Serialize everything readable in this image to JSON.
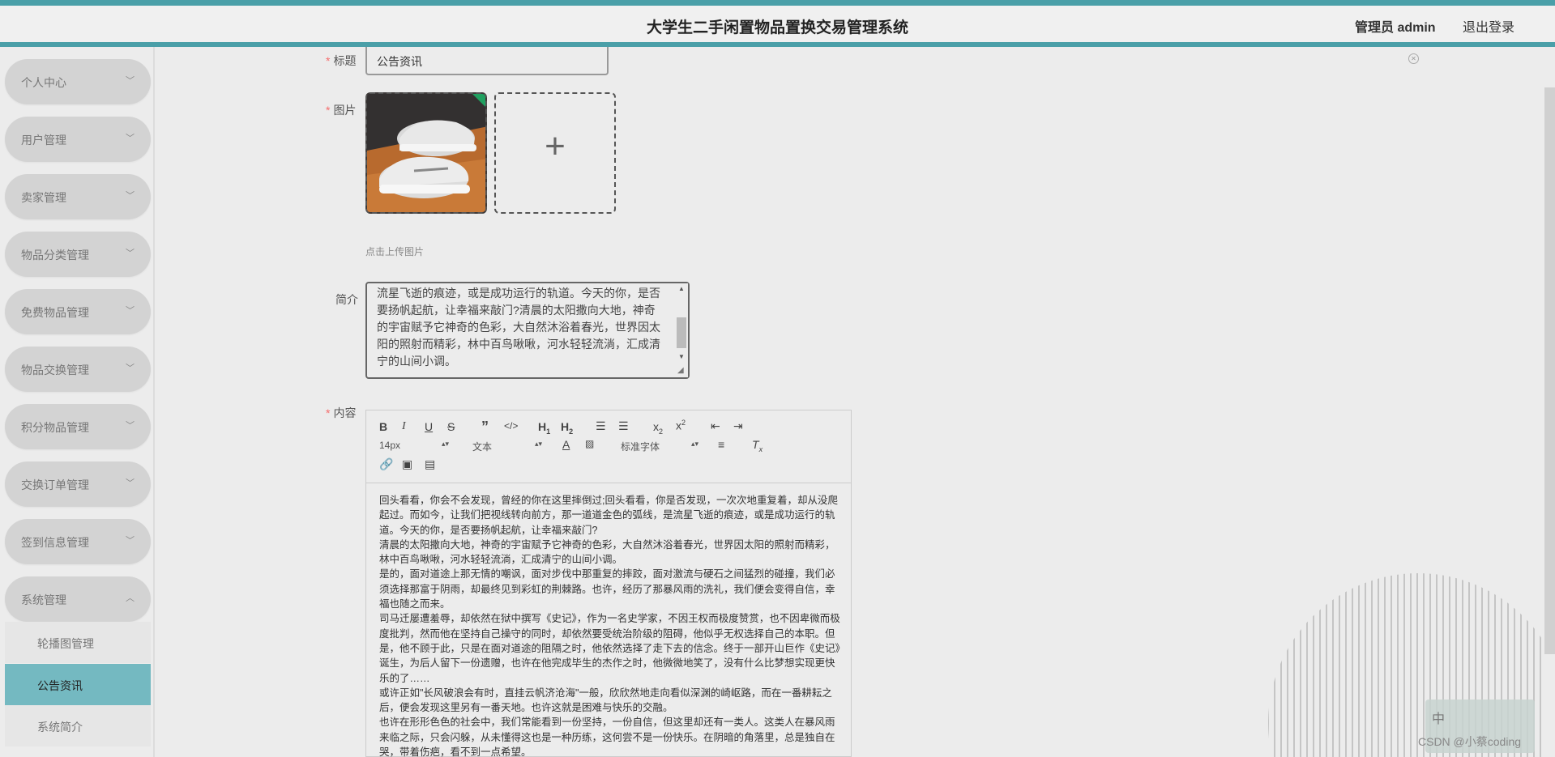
{
  "header": {
    "title": "大学生二手闲置物品置换交易管理系统",
    "user": "管理员 admin",
    "logout": "退出登录"
  },
  "sidebar": {
    "items": [
      {
        "label": "个人中心"
      },
      {
        "label": "用户管理"
      },
      {
        "label": "卖家管理"
      },
      {
        "label": "物品分类管理"
      },
      {
        "label": "免费物品管理"
      },
      {
        "label": "物品交换管理"
      },
      {
        "label": "积分物品管理"
      },
      {
        "label": "交换订单管理"
      },
      {
        "label": "签到信息管理"
      },
      {
        "label": "系统管理"
      }
    ],
    "submenu": [
      {
        "label": "轮播图管理"
      },
      {
        "label": "公告资讯"
      },
      {
        "label": "系统简介"
      }
    ],
    "active_submenu": "公告资讯"
  },
  "form": {
    "title_label": "标题",
    "title_value": "公告资讯",
    "image_label": "图片",
    "upload_hint": "点击上传图片",
    "intro_label": "简介",
    "intro_value": "流星飞逝的痕迹，或是成功运行的轨道。今天的你，是否要扬帆起航，让幸福来敲门?清晨的太阳撒向大地，神奇的宇宙赋予它神奇的色彩，大自然沐浴着春光，世界因太阳的照射而精彩，林中百鸟啾啾，河水轻轻流淌，汇成清宁的山间小调。",
    "content_label": "内容"
  },
  "editor": {
    "font_size": "14px",
    "block_type": "文本",
    "font_family": "标准字体",
    "paragraphs": [
      "回头看看，你会不会发现，曾经的你在这里摔倒过;回头看看，你是否发现，一次次地重复着，却从没爬起过。而如今，让我们把视线转向前方，那一道道金色的弧线，是流星飞逝的痕迹，或是成功运行的轨道。今天的你，是否要扬帆起航，让幸福来敲门?",
      "清晨的太阳撒向大地，神奇的宇宙赋予它神奇的色彩，大自然沐浴着春光，世界因太阳的照射而精彩，林中百鸟啾啾，河水轻轻流淌，汇成清宁的山间小调。",
      "是的，面对道途上那无情的嘲讽，面对步伐中那重复的摔跤，面对激流与硬石之间猛烈的碰撞，我们必须选择那富于阴雨，却最终见到彩虹的荆棘路。也许，经历了那暴风雨的洗礼，我们便会变得自信，幸福也随之而来。",
      "司马迁屡遭羞辱，却依然在狱中撰写《史记》，作为一名史学家，不因王权而极度赞赏，也不因卑微而极度批判，然而他在坚持自己操守的同时，却依然要受统治阶级的阻碍，他似乎无权选择自己的本职。但是，他不顾于此，只是在面对道途的阻隔之时，他依然选择了走下去的信念。终于一部开山巨作《史记》诞生，为后人留下一份遗赠，也许在他完成毕生的杰作之时，他微微地笑了，没有什么比梦想实现更快乐的了……",
      "或许正如\"长风破浪会有时，直挂云帆济沧海\"一般，欣欣然地走向看似深渊的崎岖路，而在一番耕耘之后，便会发现这里另有一番天地。也许这就是困难与快乐的交融。",
      "也许在形形色色的社会中，我们常能看到一份坚持，一份自信，但这里却还有一类人。这类人在暴风雨来临之际，只会闪躲，从未懂得这也是一种历练，这何尝不是一份快乐。在阴暗的角落里，总是独自在哭，带着伤疤，看不到一点希望。"
    ]
  },
  "badge": {
    "zh": "中"
  },
  "watermark": "CSDN @小蔡coding"
}
